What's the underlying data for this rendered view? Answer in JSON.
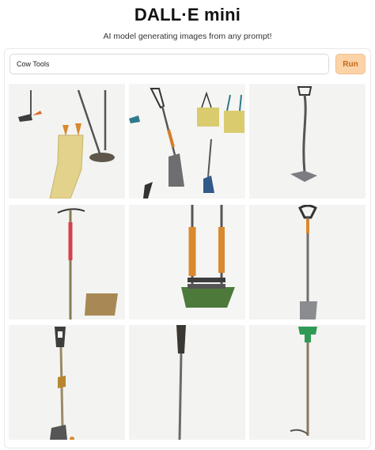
{
  "app": {
    "title": "DALL·E mini",
    "subtitle": "AI model generating images from any prompt!"
  },
  "prompt": {
    "value": "Cow Tools",
    "placeholder": ""
  },
  "run_button": {
    "label": "Run"
  },
  "colors": {
    "accent": "#fcd3a7",
    "accent_text": "#c2661b",
    "tile_background": "#f3f3f1"
  },
  "results": {
    "count": 9,
    "tiles": [
      {
        "description_icon": "tools-image"
      },
      {
        "description_icon": "tools-image"
      },
      {
        "description_icon": "tools-image"
      },
      {
        "description_icon": "tools-image"
      },
      {
        "description_icon": "tools-image"
      },
      {
        "description_icon": "tools-image"
      },
      {
        "description_icon": "tools-image"
      },
      {
        "description_icon": "tools-image"
      },
      {
        "description_icon": "tools-image"
      }
    ]
  }
}
